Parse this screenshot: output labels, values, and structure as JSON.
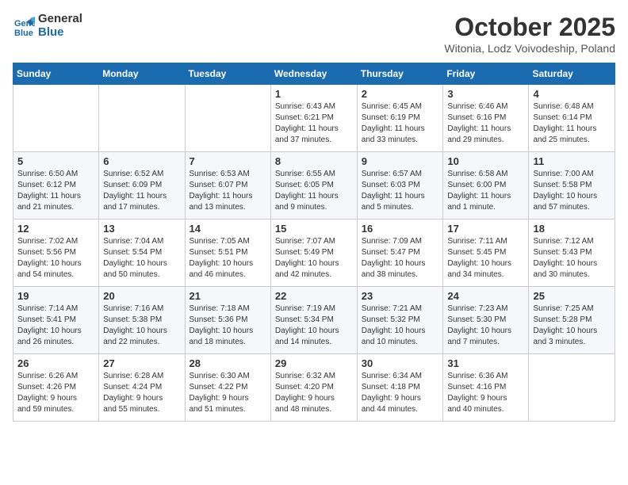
{
  "header": {
    "logo_line1": "General",
    "logo_line2": "Blue",
    "month": "October 2025",
    "location": "Witonia, Lodz Voivodeship, Poland"
  },
  "weekdays": [
    "Sunday",
    "Monday",
    "Tuesday",
    "Wednesday",
    "Thursday",
    "Friday",
    "Saturday"
  ],
  "weeks": [
    [
      {
        "day": "",
        "info": ""
      },
      {
        "day": "",
        "info": ""
      },
      {
        "day": "",
        "info": ""
      },
      {
        "day": "1",
        "info": "Sunrise: 6:43 AM\nSunset: 6:21 PM\nDaylight: 11 hours\nand 37 minutes."
      },
      {
        "day": "2",
        "info": "Sunrise: 6:45 AM\nSunset: 6:19 PM\nDaylight: 11 hours\nand 33 minutes."
      },
      {
        "day": "3",
        "info": "Sunrise: 6:46 AM\nSunset: 6:16 PM\nDaylight: 11 hours\nand 29 minutes."
      },
      {
        "day": "4",
        "info": "Sunrise: 6:48 AM\nSunset: 6:14 PM\nDaylight: 11 hours\nand 25 minutes."
      }
    ],
    [
      {
        "day": "5",
        "info": "Sunrise: 6:50 AM\nSunset: 6:12 PM\nDaylight: 11 hours\nand 21 minutes."
      },
      {
        "day": "6",
        "info": "Sunrise: 6:52 AM\nSunset: 6:09 PM\nDaylight: 11 hours\nand 17 minutes."
      },
      {
        "day": "7",
        "info": "Sunrise: 6:53 AM\nSunset: 6:07 PM\nDaylight: 11 hours\nand 13 minutes."
      },
      {
        "day": "8",
        "info": "Sunrise: 6:55 AM\nSunset: 6:05 PM\nDaylight: 11 hours\nand 9 minutes."
      },
      {
        "day": "9",
        "info": "Sunrise: 6:57 AM\nSunset: 6:03 PM\nDaylight: 11 hours\nand 5 minutes."
      },
      {
        "day": "10",
        "info": "Sunrise: 6:58 AM\nSunset: 6:00 PM\nDaylight: 11 hours\nand 1 minute."
      },
      {
        "day": "11",
        "info": "Sunrise: 7:00 AM\nSunset: 5:58 PM\nDaylight: 10 hours\nand 57 minutes."
      }
    ],
    [
      {
        "day": "12",
        "info": "Sunrise: 7:02 AM\nSunset: 5:56 PM\nDaylight: 10 hours\nand 54 minutes."
      },
      {
        "day": "13",
        "info": "Sunrise: 7:04 AM\nSunset: 5:54 PM\nDaylight: 10 hours\nand 50 minutes."
      },
      {
        "day": "14",
        "info": "Sunrise: 7:05 AM\nSunset: 5:51 PM\nDaylight: 10 hours\nand 46 minutes."
      },
      {
        "day": "15",
        "info": "Sunrise: 7:07 AM\nSunset: 5:49 PM\nDaylight: 10 hours\nand 42 minutes."
      },
      {
        "day": "16",
        "info": "Sunrise: 7:09 AM\nSunset: 5:47 PM\nDaylight: 10 hours\nand 38 minutes."
      },
      {
        "day": "17",
        "info": "Sunrise: 7:11 AM\nSunset: 5:45 PM\nDaylight: 10 hours\nand 34 minutes."
      },
      {
        "day": "18",
        "info": "Sunrise: 7:12 AM\nSunset: 5:43 PM\nDaylight: 10 hours\nand 30 minutes."
      }
    ],
    [
      {
        "day": "19",
        "info": "Sunrise: 7:14 AM\nSunset: 5:41 PM\nDaylight: 10 hours\nand 26 minutes."
      },
      {
        "day": "20",
        "info": "Sunrise: 7:16 AM\nSunset: 5:38 PM\nDaylight: 10 hours\nand 22 minutes."
      },
      {
        "day": "21",
        "info": "Sunrise: 7:18 AM\nSunset: 5:36 PM\nDaylight: 10 hours\nand 18 minutes."
      },
      {
        "day": "22",
        "info": "Sunrise: 7:19 AM\nSunset: 5:34 PM\nDaylight: 10 hours\nand 14 minutes."
      },
      {
        "day": "23",
        "info": "Sunrise: 7:21 AM\nSunset: 5:32 PM\nDaylight: 10 hours\nand 10 minutes."
      },
      {
        "day": "24",
        "info": "Sunrise: 7:23 AM\nSunset: 5:30 PM\nDaylight: 10 hours\nand 7 minutes."
      },
      {
        "day": "25",
        "info": "Sunrise: 7:25 AM\nSunset: 5:28 PM\nDaylight: 10 hours\nand 3 minutes."
      }
    ],
    [
      {
        "day": "26",
        "info": "Sunrise: 6:26 AM\nSunset: 4:26 PM\nDaylight: 9 hours\nand 59 minutes."
      },
      {
        "day": "27",
        "info": "Sunrise: 6:28 AM\nSunset: 4:24 PM\nDaylight: 9 hours\nand 55 minutes."
      },
      {
        "day": "28",
        "info": "Sunrise: 6:30 AM\nSunset: 4:22 PM\nDaylight: 9 hours\nand 51 minutes."
      },
      {
        "day": "29",
        "info": "Sunrise: 6:32 AM\nSunset: 4:20 PM\nDaylight: 9 hours\nand 48 minutes."
      },
      {
        "day": "30",
        "info": "Sunrise: 6:34 AM\nSunset: 4:18 PM\nDaylight: 9 hours\nand 44 minutes."
      },
      {
        "day": "31",
        "info": "Sunrise: 6:36 AM\nSunset: 4:16 PM\nDaylight: 9 hours\nand 40 minutes."
      },
      {
        "day": "",
        "info": ""
      }
    ]
  ]
}
